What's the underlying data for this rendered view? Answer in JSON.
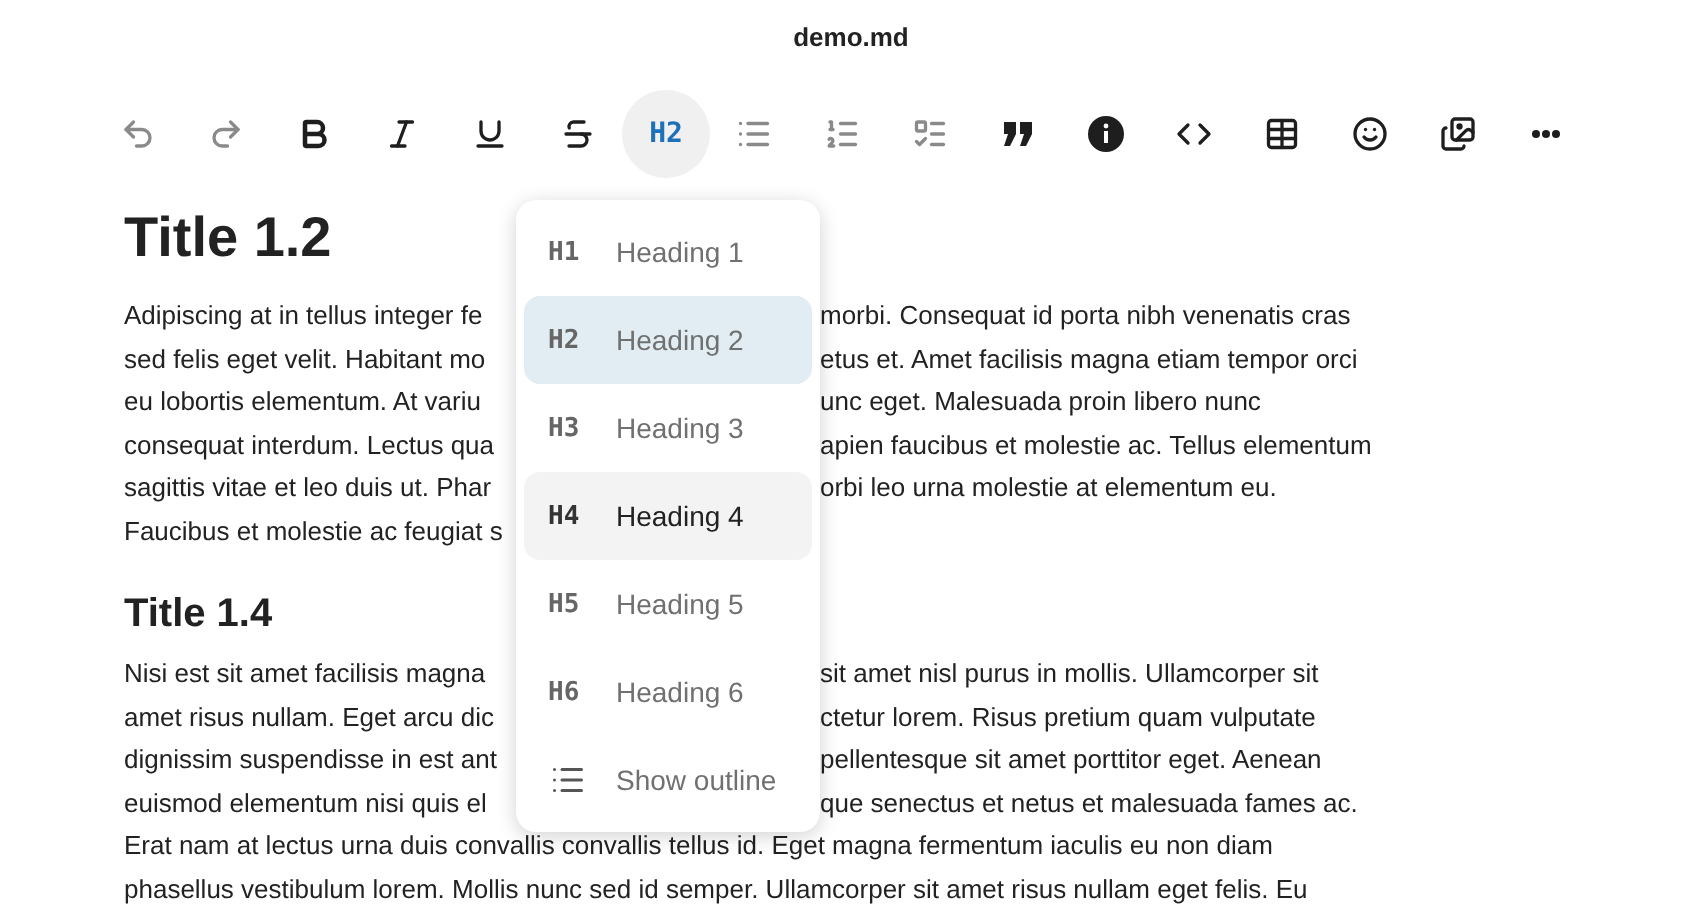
{
  "window": {
    "title": "demo.md"
  },
  "toolbar": [
    {
      "kind": "undo",
      "disabled": true
    },
    {
      "kind": "redo",
      "disabled": true
    },
    {
      "kind": "bold",
      "disabled": false
    },
    {
      "kind": "italic",
      "disabled": false
    },
    {
      "kind": "underline",
      "disabled": false
    },
    {
      "kind": "strike",
      "disabled": false
    },
    {
      "kind": "heading",
      "label": "H2",
      "selected": true,
      "disabled": false
    },
    {
      "kind": "bullets",
      "disabled": true
    },
    {
      "kind": "numbers",
      "disabled": true
    },
    {
      "kind": "tasks",
      "disabled": true
    },
    {
      "kind": "quote",
      "disabled": false
    },
    {
      "kind": "info",
      "disabled": false
    },
    {
      "kind": "code",
      "disabled": false
    },
    {
      "kind": "table",
      "disabled": false
    },
    {
      "kind": "emoji",
      "disabled": false
    },
    {
      "kind": "images",
      "disabled": false
    },
    {
      "kind": "more",
      "disabled": false
    }
  ],
  "heading_menu": [
    {
      "kind": "heading",
      "tag": "H1",
      "label": "Heading 1",
      "selected": false,
      "hovered": false
    },
    {
      "kind": "heading",
      "tag": "H2",
      "label": "Heading 2",
      "selected": true,
      "hovered": false
    },
    {
      "kind": "heading",
      "tag": "H3",
      "label": "Heading 3",
      "selected": false,
      "hovered": false
    },
    {
      "kind": "heading",
      "tag": "H4",
      "label": "Heading 4",
      "selected": false,
      "hovered": true
    },
    {
      "kind": "heading",
      "tag": "H5",
      "label": "Heading 5",
      "selected": false,
      "hovered": false
    },
    {
      "kind": "heading",
      "tag": "H6",
      "label": "Heading 6",
      "selected": false,
      "hovered": false
    },
    {
      "kind": "outline",
      "label": "Show outline",
      "selected": false,
      "hovered": false
    }
  ],
  "document": [
    {
      "kind": "h1",
      "text": "Title 1.2"
    },
    {
      "kind": "paragraph",
      "lines": [
        {
          "left": "Adipiscing at in tellus integer fe",
          "right": "morbi. Consequat id porta nibh venenatis cras"
        },
        {
          "left": "sed felis eget velit. Habitant mo",
          "right": "etus et. Amet facilisis magna etiam tempor orci"
        },
        {
          "left": "eu lobortis elementum. At variu",
          "right": "unc eget. Malesuada proin libero nunc"
        },
        {
          "left": "consequat interdum. Lectus qua",
          "right": "apien faucibus et molestie ac. Tellus elementum"
        },
        {
          "left": "sagittis vitae et leo duis ut. Phar",
          "right": "orbi leo urna molestie at elementum eu."
        },
        {
          "left": "Faucibus et molestie ac feugiat s"
        }
      ]
    },
    {
      "kind": "h2",
      "text": "Title 1.4"
    },
    {
      "kind": "paragraph",
      "lines": [
        {
          "left": "Nisi est sit amet facilisis magna",
          "right": "sit amet nisl purus in mollis. Ullamcorper sit"
        },
        {
          "left": "amet risus nullam. Eget arcu dic",
          "right": "ctetur lorem. Risus pretium quam vulputate"
        },
        {
          "left": "dignissim suspendisse in est ant",
          "right": "pellentesque sit amet porttitor eget. Aenean"
        },
        {
          "left": "euismod elementum nisi quis el",
          "right": "que senectus et netus et malesuada fames ac."
        },
        {
          "full": "Erat nam at lectus urna duis convallis convallis tellus id. Eget magna fermentum iaculis eu non diam"
        },
        {
          "full": "phasellus vestibulum lorem. Mollis nunc sed id semper. Ullamcorper sit amet risus nullam eget felis. Eu"
        }
      ]
    }
  ]
}
